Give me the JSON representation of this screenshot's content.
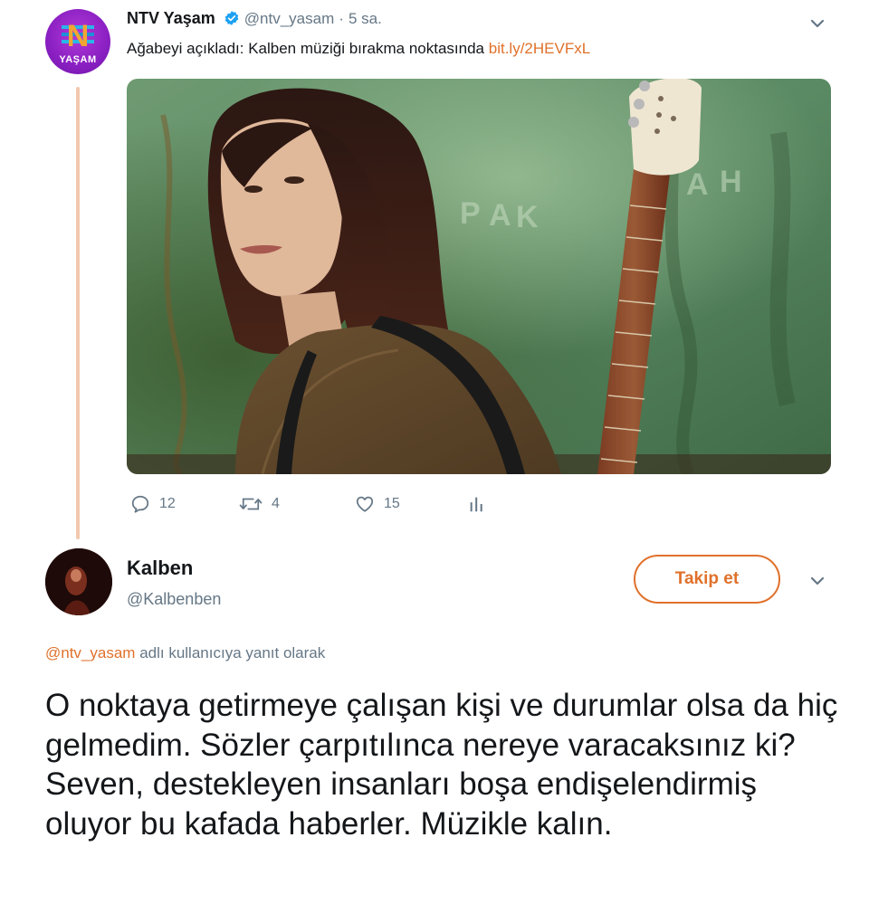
{
  "tweet": {
    "display_name": "NTV Yaşam",
    "handle": "@ntv_yasam",
    "separator": "·",
    "time": "5 sa.",
    "text": "Ağabeyi açıkladı: Kalben müziği bırakma noktasında ",
    "link": "bit.ly/2HEVFxL",
    "avatar": {
      "logo_letter": "N",
      "logo_word": "YAŞAM"
    },
    "actions": {
      "replies": "12",
      "retweets": "4",
      "likes": "15"
    }
  },
  "reply": {
    "display_name": "Kalben",
    "handle": "@Kalbenben",
    "follow_label": "Takip et",
    "reply_to_mention": "@ntv_yasam",
    "reply_to_suffix": " adlı kullanıcıya yanıt olarak",
    "text": "O noktaya getirmeye çalışan kişi ve durumlar olsa da hiç gelmedim. Sözler çarpıtılınca nereye varacaksınız ki? Seven, destekleyen insanları boşa endişelendirmiş oluyor bu kafada haberler. Müzikle kalın."
  },
  "icons": [
    "verified-badge-icon",
    "chevron-down-icon",
    "reply-icon",
    "retweet-icon",
    "like-icon",
    "analytics-icon"
  ],
  "colors": {
    "accent": "#e0712b",
    "muted": "#657786",
    "thread_line": "#f2c8ad",
    "avatar_purple": "#8a1fc2"
  }
}
